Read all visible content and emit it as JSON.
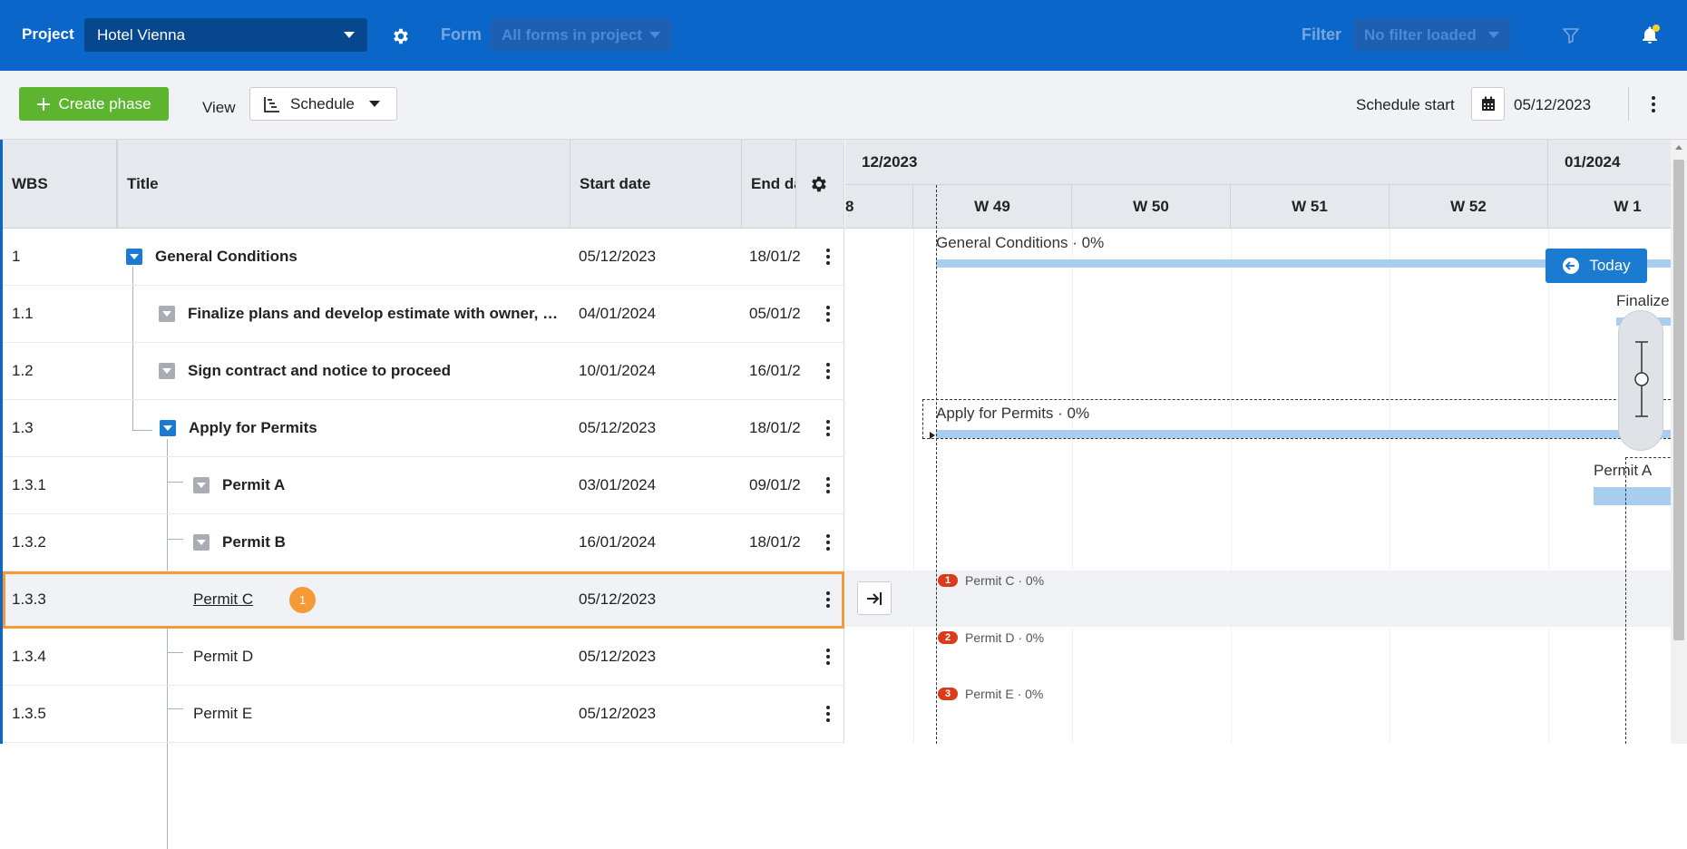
{
  "topbar": {
    "project_label": "Project",
    "project_value": "Hotel Vienna",
    "form_label": "Form",
    "form_placeholder": "All forms in project",
    "filter_label": "Filter",
    "filter_placeholder": "No filter loaded"
  },
  "toolbar": {
    "create_label": "Create phase",
    "view_label": "View",
    "view_value": "Schedule",
    "schedule_start_label": "Schedule start",
    "schedule_start_value": "05/12/2023"
  },
  "table": {
    "columns": [
      "WBS",
      "Title",
      "Start date",
      "End da"
    ],
    "rows": [
      {
        "wbs": "1",
        "title": "General Conditions",
        "start": "05/12/2023",
        "end": "18/01/2"
      },
      {
        "wbs": "1.1",
        "title": "Finalize plans and develop estimate with owner, arc...",
        "start": "04/01/2024",
        "end": "05/01/2"
      },
      {
        "wbs": "1.2",
        "title": "Sign contract and notice to proceed",
        "start": "10/01/2024",
        "end": "16/01/2"
      },
      {
        "wbs": "1.3",
        "title": "Apply for Permits",
        "start": "05/12/2023",
        "end": "18/01/2"
      },
      {
        "wbs": "1.3.1",
        "title": "Permit A",
        "start": "03/01/2024",
        "end": "09/01/2"
      },
      {
        "wbs": "1.3.2",
        "title": "Permit B",
        "start": "16/01/2024",
        "end": "18/01/2"
      },
      {
        "wbs": "1.3.3",
        "title": "Permit C",
        "start": "05/12/2023",
        "end": "",
        "badge": "1"
      },
      {
        "wbs": "1.3.4",
        "title": "Permit D",
        "start": "05/12/2023",
        "end": ""
      },
      {
        "wbs": "1.3.5",
        "title": "Permit E",
        "start": "05/12/2023",
        "end": ""
      }
    ]
  },
  "gantt": {
    "months": [
      "12/2023",
      "01/2024"
    ],
    "weeks": [
      "8",
      "W 49",
      "W 50",
      "W 51",
      "W 52",
      "W 1"
    ],
    "today_label": "Today",
    "bars": {
      "general": "General Conditions · 0%",
      "finalize": "Finalize",
      "apply": "Apply for Permits · 0%",
      "permit_a": "Permit A"
    },
    "milestones": [
      {
        "num": "1",
        "label": "Permit C · 0%"
      },
      {
        "num": "2",
        "label": "Permit D · 0%"
      },
      {
        "num": "3",
        "label": "Permit E · 0%"
      }
    ]
  },
  "colors": {
    "brand_blue": "#0a66c8",
    "create_green": "#5db42f",
    "selection_orange": "#f59a34",
    "bar_blue": "#a9cdee",
    "milestone_red": "#d93b1b"
  }
}
